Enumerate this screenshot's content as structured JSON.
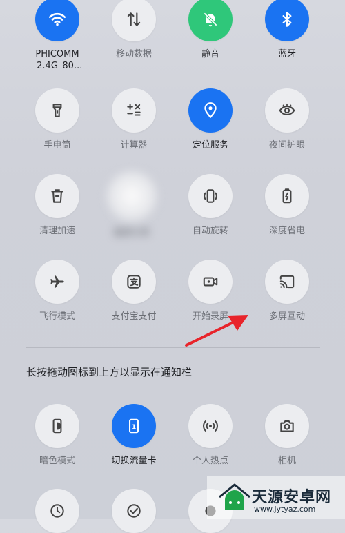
{
  "tiles": {
    "wifi": {
      "label": "PHICOMM\n_2.4G_80..."
    },
    "mobile_data": {
      "label": "移动数据"
    },
    "mute": {
      "label": "静音"
    },
    "bluetooth": {
      "label": "蓝牙"
    },
    "flashlight": {
      "label": "手电筒"
    },
    "calculator": {
      "label": "计算器"
    },
    "location": {
      "label": "定位服务"
    },
    "night_eye": {
      "label": "夜间护眼"
    },
    "cleanup": {
      "label": "清理加速"
    },
    "blurred": {
      "label": "截屏分享"
    },
    "auto_rotate": {
      "label": "自动旋转"
    },
    "power_saver": {
      "label": "深度省电"
    },
    "airplane": {
      "label": "飞行模式"
    },
    "alipay": {
      "label": "支付宝支付"
    },
    "screen_record": {
      "label": "开始录屏"
    },
    "cast": {
      "label": "多屏互动"
    },
    "dark_mode": {
      "label": "暗色模式"
    },
    "sim_switch": {
      "label": "切换流量卡",
      "sim_number": "1"
    },
    "hotspot": {
      "label": "个人热点"
    },
    "camera": {
      "label": "相机"
    }
  },
  "hint": "长按拖动图标到上方以显示在通知栏",
  "watermark": {
    "name": "天源安卓网",
    "url": "www.jytyaz.com"
  },
  "colors": {
    "accent_blue": "#1a73f2",
    "accent_green": "#2fc77a",
    "arrow_red": "#e8242b"
  }
}
